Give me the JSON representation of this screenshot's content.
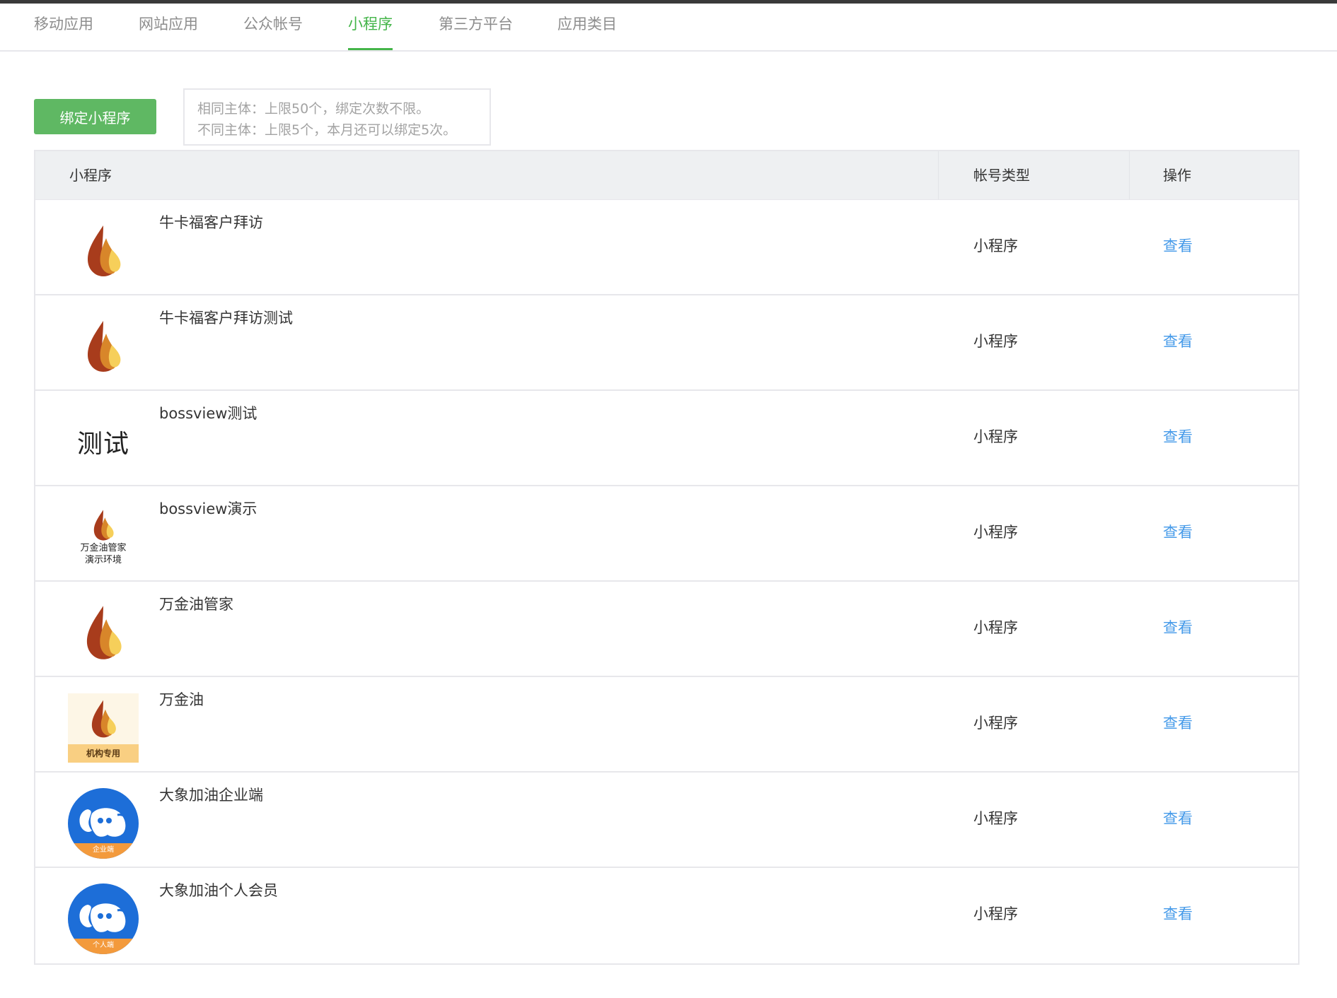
{
  "tabs": [
    {
      "label": "移动应用",
      "active": false
    },
    {
      "label": "网站应用",
      "active": false
    },
    {
      "label": "公众帐号",
      "active": false
    },
    {
      "label": "小程序",
      "active": true
    },
    {
      "label": "第三方平台",
      "active": false
    },
    {
      "label": "应用类目",
      "active": false
    }
  ],
  "toolbar": {
    "bind_label": "绑定小程序",
    "notice_line1": "相同主体：上限50个，绑定次数不限。",
    "notice_line2": "不同主体：上限5个，本月还可以绑定5次。"
  },
  "table": {
    "headers": {
      "app": "小程序",
      "type": "帐号类型",
      "action": "操作"
    },
    "rows": [
      {
        "name": "牛卡福客户拜访",
        "type": "小程序",
        "action": "查看",
        "icon": "flame-icon"
      },
      {
        "name": "牛卡福客户拜访测试",
        "type": "小程序",
        "action": "查看",
        "icon": "flame-icon"
      },
      {
        "name": "bossview测试",
        "type": "小程序",
        "action": "查看",
        "icon": "text-icon",
        "icon_text": "测试"
      },
      {
        "name": "bossview演示",
        "type": "小程序",
        "action": "查看",
        "icon": "flame-caption-icon",
        "icon_caption1": "万金油管家",
        "icon_caption2": "演示环境"
      },
      {
        "name": "万金油管家",
        "type": "小程序",
        "action": "查看",
        "icon": "flame-icon"
      },
      {
        "name": "万金油",
        "type": "小程序",
        "action": "查看",
        "icon": "flame-org-icon",
        "icon_caption1": "机构专用"
      },
      {
        "name": "大象加油企业端",
        "type": "小程序",
        "action": "查看",
        "icon": "elephant-icon",
        "icon_caption1": "企业端"
      },
      {
        "name": "大象加油个人会员",
        "type": "小程序",
        "action": "查看",
        "icon": "elephant-icon",
        "icon_caption1": "个人端"
      }
    ]
  },
  "colors": {
    "accent_green": "#44b549",
    "button_green": "#5fb863",
    "link_blue": "#459ae9",
    "header_bg": "#eef0f2",
    "flame_dark": "#a83c1c",
    "flame_mid": "#d8862a",
    "flame_light": "#f6cf5a",
    "elephant_blue": "#1d6ed8",
    "elephant_orange": "#f39a3c"
  }
}
